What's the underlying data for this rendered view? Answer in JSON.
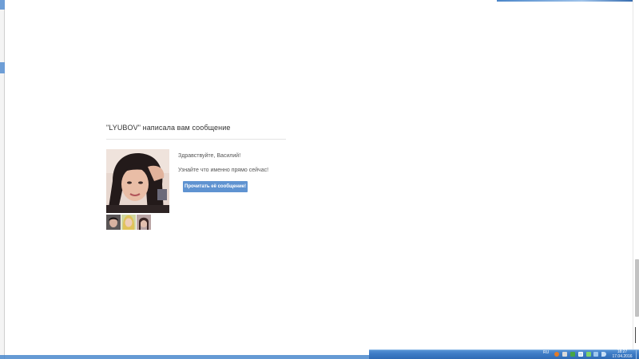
{
  "message": {
    "heading": "\"LYUBOV\" написала вам сообщение",
    "greeting": "Здравствуйте, Василий!",
    "subtext": "Узнайте что именно прямо сейчас!",
    "button_label": "Прочитать её сообщение!",
    "button_color": "#5f93d1"
  },
  "icons": {
    "avatar": "user-photo",
    "thumbnails": [
      "photo-thumb-1",
      "photo-thumb-2",
      "photo-thumb-3"
    ]
  },
  "taskbar": {
    "language": "RU",
    "time": "18:27",
    "date": "17.04.2016",
    "color": "#3d7cc6"
  }
}
